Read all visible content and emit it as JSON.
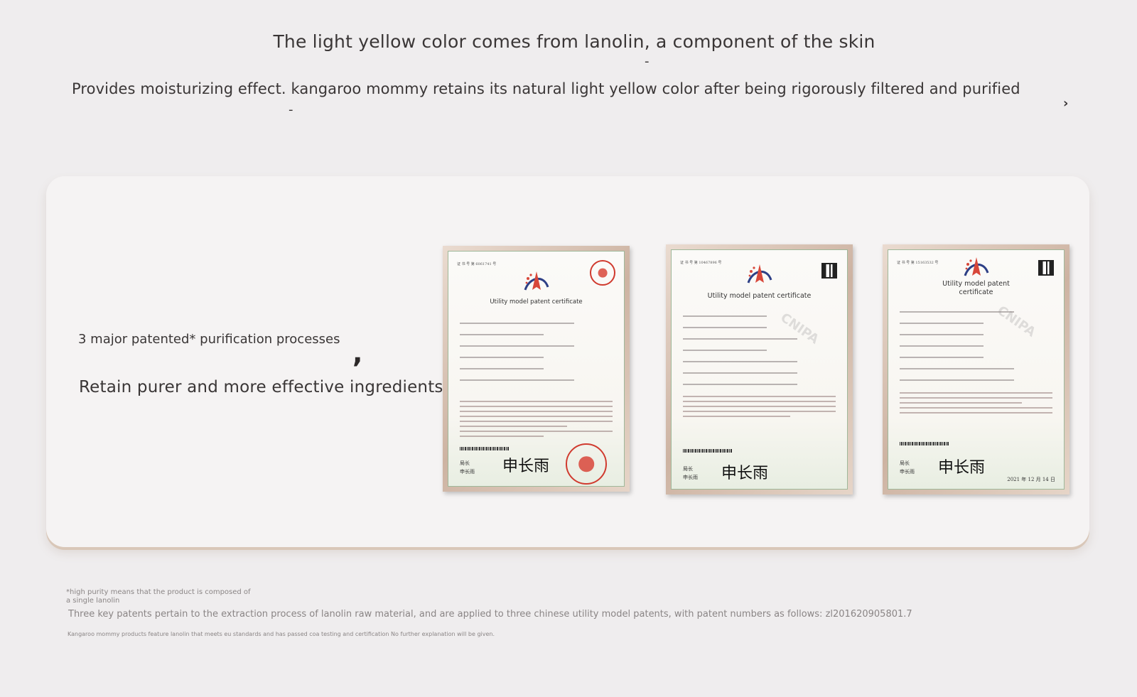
{
  "header": {
    "line1": "The light yellow color comes from lanolin, a component of the skin",
    "line2": "Provides moisturizing effect. kangaroo mommy retains its natural light yellow color after being rigorously filtered and purified"
  },
  "card": {
    "subtitle": "3 major patented* purification processes",
    "title": "Retain purer and more effective ingredients"
  },
  "certificates": [
    {
      "title": "Utility model patent certificate",
      "signer_label": "局长\n申长雨",
      "has_seal": true,
      "has_qr": false
    },
    {
      "title": "Utility model patent certificate",
      "signer_label": "局长\n申长雨",
      "has_seal": false,
      "has_qr": true,
      "watermark": "CNIPA"
    },
    {
      "title": "Utility model patent\ncertificate",
      "signer_label": "局长\n申长雨",
      "has_seal": false,
      "has_qr": true,
      "watermark": "CNIPA",
      "date": "2021 年 12 月 14 日"
    }
  ],
  "notes": {
    "note1": "*high purity means that the product is composed of a single lanolin",
    "note2": "Three key patents pertain to the extraction process of lanolin raw material, and are applied to three chinese utility model patents, with patent numbers as follows: zl201620905801.7",
    "note3": "Kangaroo mommy products feature lanolin that meets eu standards and has passed coa testing and certification No further explanation will be given."
  },
  "colors": {
    "background": "#efedee",
    "card": "#f5f3f3",
    "text": "#3a3636",
    "muted": "#8a8585",
    "seal": "#d03a2e"
  }
}
